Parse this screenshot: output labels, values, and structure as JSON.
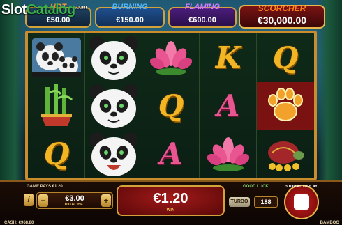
{
  "watermark": {
    "text_slot": "Slot",
    "text_catalog": "Catalog",
    "text_com": ".com"
  },
  "jackpots": [
    {
      "name": "HOT",
      "value": "€50.00"
    },
    {
      "name": "BURNING",
      "value": "€150.00"
    },
    {
      "name": "FLAMING",
      "value": "€600.00"
    },
    {
      "name": "SCORCHER",
      "value": "€30,000.00"
    }
  ],
  "reels": [
    [
      "panda-family",
      "bamboo-pot",
      "gold-q"
    ],
    [
      "panda-head",
      "panda-head",
      "panda-head"
    ],
    [
      "pink-lotus",
      "gold-q",
      "pink-a"
    ],
    [
      "gold-k",
      "pink-a",
      "pink-lotus"
    ],
    [
      "gold-q",
      "tiger-paw",
      "turtle-gold"
    ]
  ],
  "colors": {
    "frame": "#c98d2c",
    "win_bg": "#a31a1a",
    "gold": "#f2b625",
    "pink": "#e85590"
  },
  "console": {
    "game_pays": "GAME PAYS €1.20",
    "info_label": "i",
    "minus_label": "−",
    "plus_label": "+",
    "total_bet": "€3.00",
    "total_bet_label": "TOTAL BET",
    "win_value": "€1.20",
    "win_label": "WIN",
    "good_luck": "GOOD LUCK!",
    "turbo_label": "TURBO",
    "autoplay_count": "188",
    "stop_autoplay_label": "STOP AUTOPLAY",
    "cash": "CASH: €968.80",
    "brand": "BAMBOO"
  }
}
